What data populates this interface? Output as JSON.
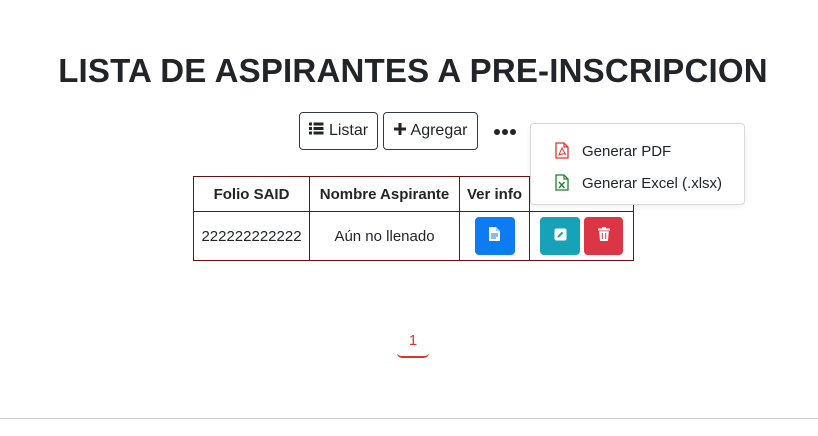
{
  "page": {
    "title": "LISTA DE ASPIRANTES A PRE-INSCRIPCION"
  },
  "toolbar": {
    "listar_label": "Listar",
    "agregar_label": "Agregar"
  },
  "dropdown": {
    "items": [
      {
        "label": "Generar PDF",
        "icon": "pdf-file-icon",
        "color": "#e0352b"
      },
      {
        "label": "Generar Excel (.xlsx)",
        "icon": "excel-file-icon",
        "color": "#1e7e34"
      }
    ]
  },
  "table": {
    "headers": [
      "Folio SAID",
      "Nombre Aspirante",
      "Ver info",
      ""
    ],
    "rows": [
      {
        "folio": "222222222222",
        "nombre": "Aún no llenado"
      }
    ]
  },
  "pagination": {
    "current": "1"
  },
  "colors": {
    "primary": "#0d7cf2",
    "info": "#17a2b8",
    "danger": "#dc3545",
    "accent": "#e0352b",
    "border": "#6b1010"
  }
}
